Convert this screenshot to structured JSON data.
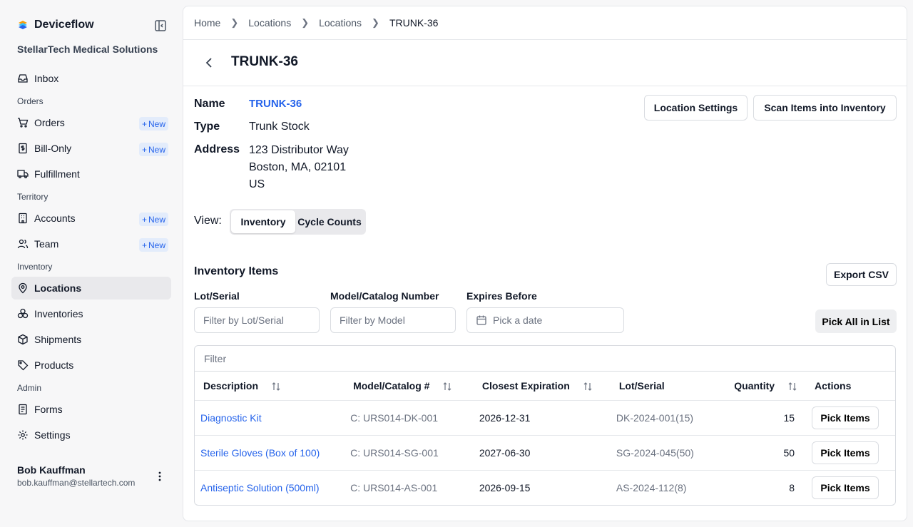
{
  "sidebar": {
    "brand": "Deviceflow",
    "org": "StellarTech Medical Solutions",
    "inbox": "Inbox",
    "sections": {
      "orders": "Orders",
      "territory": "Territory",
      "inventory": "Inventory",
      "admin": "Admin"
    },
    "items": {
      "orders": "Orders",
      "bill_only": "Bill-Only",
      "fulfillment": "Fulfillment",
      "accounts": "Accounts",
      "team": "Team",
      "locations": "Locations",
      "inventories": "Inventories",
      "shipments": "Shipments",
      "products": "Products",
      "forms": "Forms",
      "settings": "Settings"
    },
    "new_label": "New",
    "user": {
      "name": "Bob Kauffman",
      "email": "bob.kauffman@stellartech.com"
    }
  },
  "breadcrumb": [
    "Home",
    "Locations",
    "Locations",
    "TRUNK-36"
  ],
  "page_title": "TRUNK-36",
  "details": {
    "name_label": "Name",
    "name_value": "TRUNK-36",
    "type_label": "Type",
    "type_value": "Trunk Stock",
    "address_label": "Address",
    "address_lines": [
      "123 Distributor Way",
      "Boston, MA, 02101",
      "US"
    ]
  },
  "actions": {
    "location_settings": "Location Settings",
    "scan_items": "Scan Items into Inventory"
  },
  "view": {
    "label": "View:",
    "options": [
      "Inventory",
      "Cycle Counts"
    ],
    "selected": "Inventory"
  },
  "inventory": {
    "title": "Inventory Items",
    "export": "Export CSV",
    "filters": {
      "lot_label": "Lot/Serial",
      "lot_placeholder": "Filter by Lot/Serial",
      "model_label": "Model/Catalog Number",
      "model_placeholder": "Filter by Model",
      "expires_label": "Expires Before",
      "expires_placeholder": "Pick a date"
    },
    "pick_all": "Pick All in List",
    "table_filter_placeholder": "Filter",
    "columns": [
      "Description",
      "Model/Catalog #",
      "Closest Expiration",
      "Lot/Serial",
      "Quantity",
      "Actions"
    ],
    "rows": [
      {
        "description": "Diagnostic Kit",
        "model": "C: URS014-DK-001",
        "expiration": "2026-12-31",
        "lot": "DK-2024-001(15)",
        "quantity": "15",
        "action": "Pick Items"
      },
      {
        "description": "Sterile Gloves (Box of 100)",
        "model": "C: URS014-SG-001",
        "expiration": "2027-06-30",
        "lot": "SG-2024-045(50)",
        "quantity": "50",
        "action": "Pick Items"
      },
      {
        "description": "Antiseptic Solution (500ml)",
        "model": "C: URS014-AS-001",
        "expiration": "2026-09-15",
        "lot": "AS-2024-112(8)",
        "quantity": "8",
        "action": "Pick Items"
      }
    ]
  },
  "colors": {
    "accent": "#2563eb",
    "new_badge_bg": "#e3ecfb",
    "active_nav_bg": "#e9e9ec"
  }
}
